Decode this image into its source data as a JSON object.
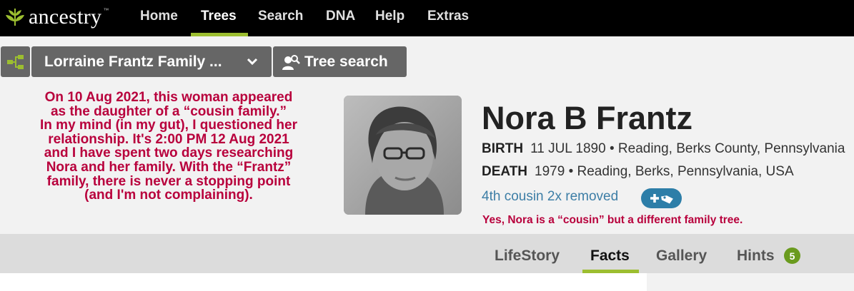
{
  "brand": {
    "name": "ancestry",
    "logo_icon": "leaf-icon",
    "accent": "#9cbe30"
  },
  "nav": {
    "items": [
      {
        "label": "Home"
      },
      {
        "label": "Trees",
        "active": true
      },
      {
        "label": "Search"
      },
      {
        "label": "DNA"
      },
      {
        "label": "Help"
      },
      {
        "label": "Extras"
      }
    ]
  },
  "toolbar": {
    "tree_icon": "pedigree-icon",
    "family_tree_label": "Lorraine Frantz Family ...",
    "tree_search_label": "Tree search"
  },
  "annotation_left": [
    "On 10 Aug 2021, this woman appeared",
    "as the daughter of a “cousin family.”",
    "In my mind (in my gut), I questioned her",
    "relationship. It's 2:00 PM 12 Aug 2021",
    "and I have spent two days researching",
    "Nora and her family. With the “Frantz”",
    "family, there is never a stopping point",
    "(and I'm not complaining)."
  ],
  "person": {
    "name": "Nora B Frantz",
    "birth_label": "BIRTH",
    "birth_value": "11 JUL 1890 • Reading, Berks County, Pennsylvania",
    "death_label": "DEATH",
    "death_value": "1979 • Reading, Berks, Pennsylvania, USA",
    "relationship": "4th cousin 2x removed",
    "add_tag_icon": "add-tag-icon",
    "annotation_right": "Yes, Nora is a “cousin” but a different family tree."
  },
  "tabs": [
    {
      "label": "LifeStory"
    },
    {
      "label": "Facts",
      "active": true
    },
    {
      "label": "Gallery"
    },
    {
      "label": "Hints",
      "badge": "5"
    }
  ],
  "colors": {
    "annotation": "#b8003c",
    "link": "#3d7ea6",
    "badge": "#6a9b1e"
  }
}
